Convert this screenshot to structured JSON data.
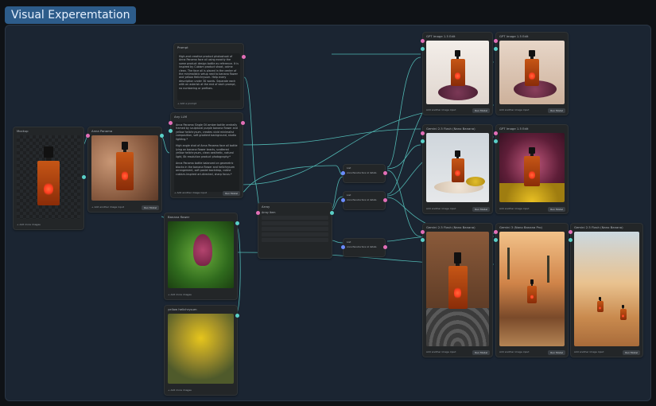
{
  "app": {
    "title": "Visual Experemtation"
  },
  "colors": {
    "canvas": "#1b2532",
    "node": "#232628",
    "wire": "#5ad0c8",
    "port_pink": "#e36fb8",
    "port_blue": "#6b8cff"
  },
  "nodes": {
    "mockup": {
      "title": "Mockup",
      "footer": "+ Add more images"
    },
    "anna": {
      "title": "Anna Panama",
      "footer": "+ Add another image input",
      "button": "Run Model"
    },
    "prompt": {
      "title": "Prompt",
      "text": "High-end creative product photoshoot of Anna Panama face oil using exactly the same product design bottle as reference. It is inspired by Cubism product shoot, calme clean. The face oil is placed in the center of the minimalistic setup next to banana flower and yellow Helichrysum. Help every description under 30 words. Separate each with an asterisk at the end of each prompt, no numbering or prefixes.",
      "footer": "+ Add a prompt"
    },
    "llm": {
      "title": "Any LLM",
      "text": "Anna Panama Single Oil amber bottle centrally framed by sculptural purple banana flower and yellow helichrysum, creates vivid minimalist composition, soft gradient background, studio lighting.*\n\nHigh angle shot of Anna Panama face oil bottle lying on banana flower bracts, scattered yellow helichrysum, clean aesthetic, natural light, 8k resolution product photography.*\n\nAnna Panama bottle balanced on geometric blocks in the banana flower and helichrysum arrangement, soft pastel backdrop, cubist cubism-inspired art-directed, sharp focus.*",
      "footer": "+ Add another image input",
      "button": "Run Model"
    },
    "banana": {
      "title": "Banana flower",
      "footer": "+ Add more images"
    },
    "yellow": {
      "title": "yellow helichrysum",
      "footer": "+ Add more images"
    },
    "array": {
      "title": "Array",
      "sub": "Array Item"
    },
    "list": [
      {
        "title": "List",
        "item": "Anna Panama face oil details"
      },
      {
        "title": "List",
        "item": "Anna Panama face oil details"
      },
      {
        "title": "List",
        "item": "Anna Panama face oil details"
      }
    ],
    "outputs": {
      "o1": {
        "title": "GPT Image 1.5 Edit",
        "footer": "Add another image input",
        "button": "Run Model"
      },
      "o2": {
        "title": "GPT Image 1.5 Edit",
        "footer": "Add another image input",
        "button": "Run Model"
      },
      "o3": {
        "title": "Gemini 2.5 Flash (Nano Banana)",
        "footer": "Add another image input",
        "button": "Run Model"
      },
      "o4": {
        "title": "GPT Image 1.5 Edit",
        "footer": "Add another image input",
        "button": "Run Model"
      },
      "o5": {
        "title": "Gemini 2.5 Flash (Nano Banana)",
        "footer": "Add another image input",
        "button": "Run Model"
      },
      "o6": {
        "title": "Gemini 3 (Nano Banana Pro)",
        "footer": "Add another image input",
        "button": "Run Model"
      },
      "o7": {
        "title": "Gemini 2.5 Flash (Nano Banana)",
        "footer": "Add another image input",
        "button": "Run Model"
      }
    }
  }
}
